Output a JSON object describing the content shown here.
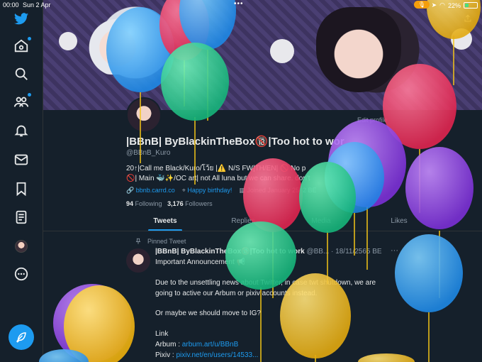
{
  "status": {
    "time": "00:00",
    "date": "Sun 2 Apr",
    "battery": "22%"
  },
  "sidebar": {
    "items": [
      "twitter-logo",
      "home",
      "explore",
      "communities",
      "notifications",
      "messages",
      "bookmarks",
      "lists",
      "profile",
      "more"
    ]
  },
  "profile": {
    "edit_label": "Edit profile",
    "name": "|BBnB| ByBlackinTheBox🔞|Too hot to wor",
    "handle": "@BBnB_Kuro",
    "bio_line1": "20↑|Call me Black/Kuro/โว้ย |⚠️ N/S FW|TH/EN| 🚫 No p",
    "bio_line2": "🚫| Main 🐳✨/OC art| not All luna but we can share. don't",
    "link": "bbnb.carrd.co",
    "birthday": "Happy birthday!",
    "joined": "Joined January 2562 BE",
    "following_count": "94",
    "following_label": "Following",
    "followers_count": "3,176",
    "followers_label": "Followers"
  },
  "tabs": [
    "Tweets",
    "Replies",
    "Media",
    "Likes"
  ],
  "tweet": {
    "pinned_label": "Pinned Tweet",
    "name": "|BBnB| ByBlackinTheBox🔞|Too hot to work",
    "meta": "@BB... · 18/11/2565 BE",
    "line1": "Important Announcement 📢",
    "line2": "Due to the unsettling news about Twitter, in case twt shutdown, we are",
    "line3": "going to active our Arbum or pixiv accounts instead.",
    "line4": "Or maybe we should move to IG?",
    "line5": "Link",
    "arbum_label": "Arbum :",
    "arbum_link": "arbum.art/u/BBnB",
    "pixiv_label": "Pixiv :",
    "pixiv_link": "pixiv.net/en/users/14533..."
  },
  "colors": {
    "accent": "#1d9bf0",
    "background": "#15202b"
  }
}
